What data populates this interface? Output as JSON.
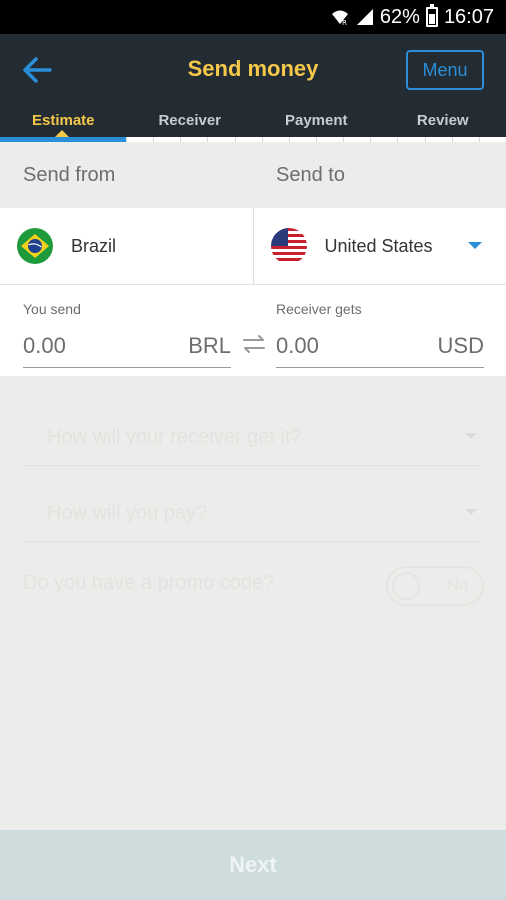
{
  "status_bar": {
    "battery": "62%",
    "time": "16:07"
  },
  "header": {
    "title": "Send money",
    "menu_label": "Menu"
  },
  "steps": [
    "Estimate",
    "Receiver",
    "Payment",
    "Review"
  ],
  "active_step": "Estimate",
  "send_from": {
    "label": "Send from",
    "country": "Brazil"
  },
  "send_to": {
    "label": "Send to",
    "country": "United States"
  },
  "you_send": {
    "label": "You send",
    "value": "0.00",
    "currency": "BRL"
  },
  "receiver_gets": {
    "label": "Receiver gets",
    "value": "0.00",
    "currency": "USD"
  },
  "form": {
    "receive_method_placeholder": "How will your receiver get it?",
    "pay_method_placeholder": "How will you pay?",
    "promo_question": "Do you have a promo code?",
    "promo_toggle": "No"
  },
  "next_label": "Next",
  "colors": {
    "header_bg": "#232b33",
    "accent": "#2a8fd8",
    "title": "#f5c84a",
    "next_bg": "#cfdcde"
  }
}
